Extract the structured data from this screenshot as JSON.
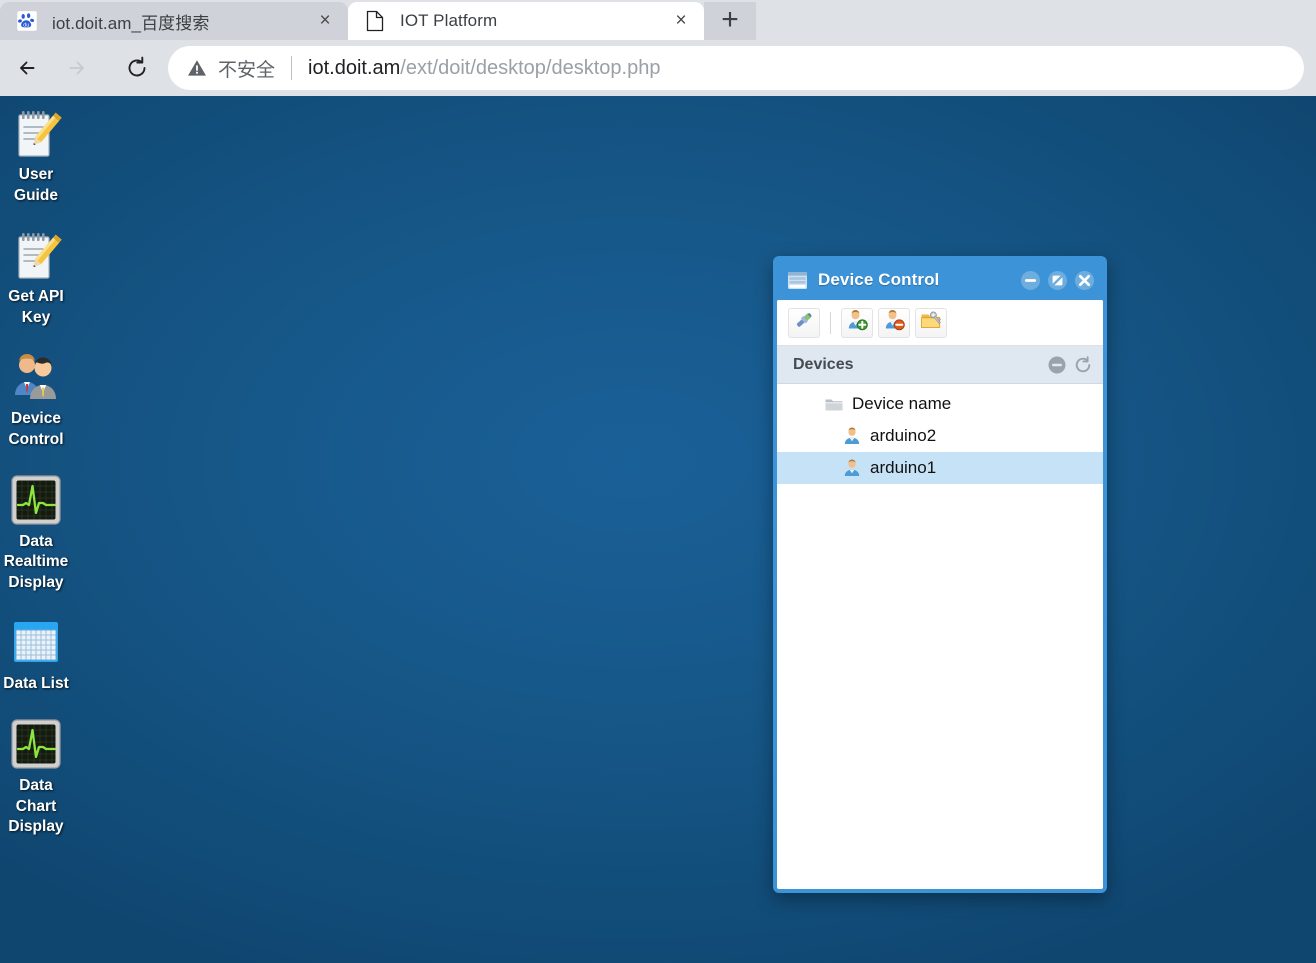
{
  "browser": {
    "tabs": [
      {
        "title": "iot.doit.am_百度搜索",
        "favicon": "baidu-paw-icon",
        "active": false,
        "close_label": "×"
      },
      {
        "title": "IOT Platform",
        "favicon": "page-document-icon",
        "active": true,
        "close_label": "×"
      }
    ],
    "new_tab_label": "+",
    "nav": {
      "back_label": "←",
      "forward_label": "→",
      "reload_label": "⟳"
    },
    "omnibox": {
      "security_text": "不安全",
      "security_icon": "warning-triangle-icon",
      "url_host": "iot.doit.am",
      "url_path": "/ext/doit/desktop/desktop.php"
    }
  },
  "desktop": {
    "background_color": "#165788",
    "icons": [
      {
        "label": "User Guide",
        "icon": "notepad-pencil-icon"
      },
      {
        "label": "Get API Key",
        "icon": "notepad-pencil-icon"
      },
      {
        "label": "Device Control",
        "icon": "two-users-icon"
      },
      {
        "label": "Data Realtime Display",
        "icon": "waveform-monitor-icon"
      },
      {
        "label": "Data List",
        "icon": "table-grid-icon"
      },
      {
        "label": "Data Chart Display",
        "icon": "waveform-monitor-icon"
      }
    ]
  },
  "window": {
    "title": "Device Control",
    "title_icon": "window-list-icon",
    "accent_color": "#3c93d8",
    "controls": [
      {
        "name": "minimize",
        "icon": "minus-circle-icon"
      },
      {
        "name": "maximize",
        "icon": "slash-circle-icon"
      },
      {
        "name": "close",
        "icon": "x-circle-icon"
      }
    ],
    "toolbar": [
      {
        "name": "connect-device",
        "icon": "plug-connector-icon"
      },
      {
        "name": "add-device",
        "icon": "user-add-icon"
      },
      {
        "name": "delete-device",
        "icon": "user-remove-icon"
      },
      {
        "name": "edit-key",
        "icon": "folder-key-icon"
      }
    ],
    "panel": {
      "title": "Devices",
      "tools": [
        {
          "name": "collapse",
          "icon": "minus-circle-gray-icon"
        },
        {
          "name": "refresh",
          "icon": "refresh-arrow-icon"
        }
      ],
      "tree": [
        {
          "label": "Device name",
          "icon": "folder-icon",
          "level": 1,
          "selected": false
        },
        {
          "label": "arduino2",
          "icon": "user-icon",
          "level": 2,
          "selected": false
        },
        {
          "label": "arduino1",
          "icon": "user-icon",
          "level": 2,
          "selected": true
        }
      ]
    }
  }
}
